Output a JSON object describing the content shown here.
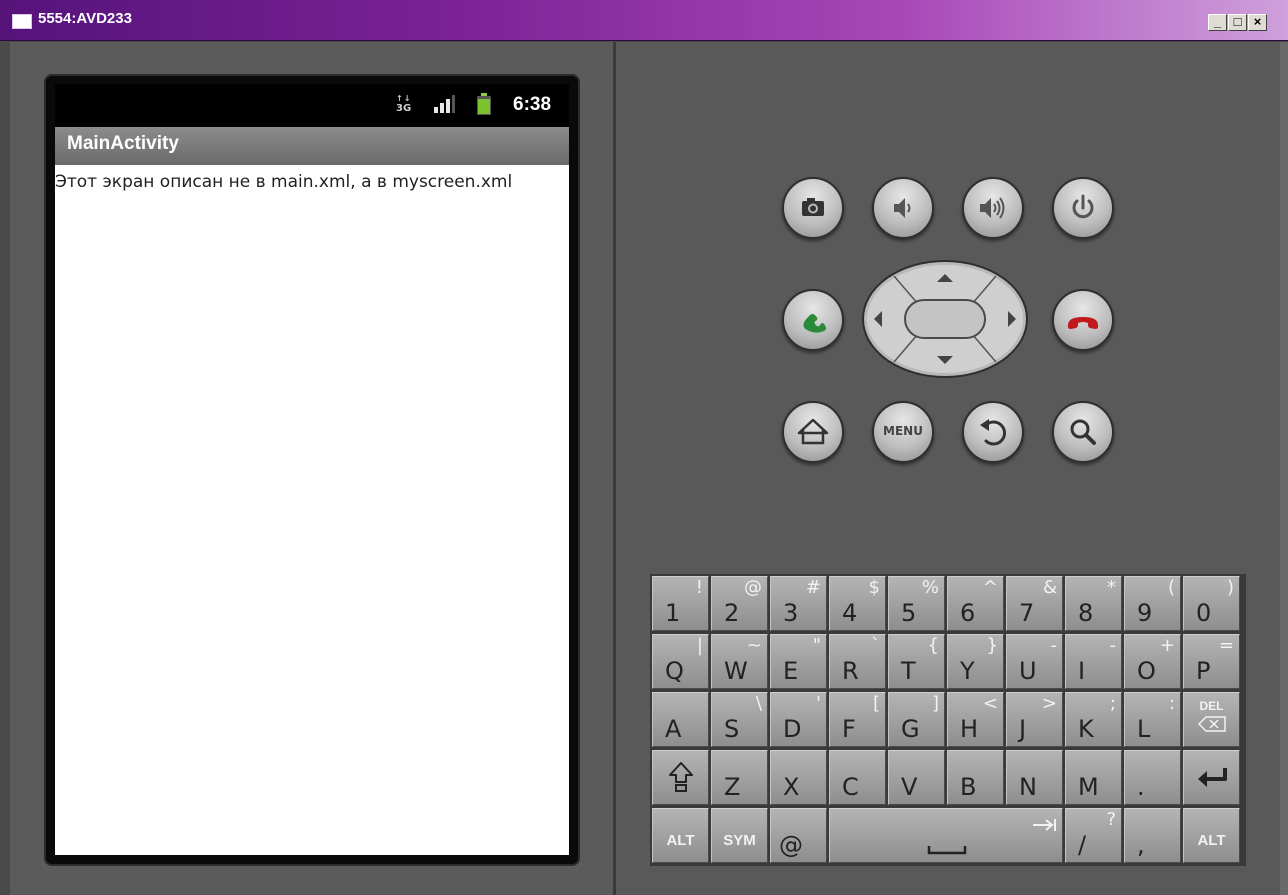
{
  "window": {
    "title": "5554:AVD233",
    "minimize_label": "_",
    "maximize_label": "□",
    "close_label": "×"
  },
  "device": {
    "status_bar": {
      "network": "3G",
      "time": "6:38"
    },
    "app_title": "MainActivity",
    "content_text": "Этот экран описан не в main.xml, а в myscreen.xml"
  },
  "hardware_buttons": {
    "menu_label": "MENU",
    "icons": [
      "camera-icon",
      "volume-down-icon",
      "volume-up-icon",
      "power-icon",
      "call-icon",
      "end-call-icon",
      "home-icon",
      "back-icon",
      "search-icon"
    ]
  },
  "keyboard": {
    "rows": [
      [
        {
          "main": "1",
          "alt": "!"
        },
        {
          "main": "2",
          "alt": "@"
        },
        {
          "main": "3",
          "alt": "#"
        },
        {
          "main": "4",
          "alt": "$"
        },
        {
          "main": "5",
          "alt": "%"
        },
        {
          "main": "6",
          "alt": "^"
        },
        {
          "main": "7",
          "alt": "&"
        },
        {
          "main": "8",
          "alt": "*"
        },
        {
          "main": "9",
          "alt": "("
        },
        {
          "main": "0",
          "alt": ")"
        }
      ],
      [
        {
          "main": "Q",
          "alt": "|"
        },
        {
          "main": "W",
          "alt": "~"
        },
        {
          "main": "E",
          "alt": "\""
        },
        {
          "main": "R",
          "alt": "`"
        },
        {
          "main": "T",
          "alt": "{"
        },
        {
          "main": "Y",
          "alt": "}"
        },
        {
          "main": "U",
          "alt": "-"
        },
        {
          "main": "I",
          "alt": "-"
        },
        {
          "main": "O",
          "alt": "+"
        },
        {
          "main": "P",
          "alt": "="
        }
      ],
      [
        {
          "main": "A",
          "alt": ""
        },
        {
          "main": "S",
          "alt": "\\"
        },
        {
          "main": "D",
          "alt": "'"
        },
        {
          "main": "F",
          "alt": "["
        },
        {
          "main": "G",
          "alt": "]"
        },
        {
          "main": "H",
          "alt": "<"
        },
        {
          "main": "J",
          "alt": ">"
        },
        {
          "main": "K",
          "alt": ";"
        },
        {
          "main": "L",
          "alt": ":"
        },
        {
          "main": "DEL",
          "alt": ""
        }
      ],
      [
        {
          "main": "",
          "alt": ""
        },
        {
          "main": "Z",
          "alt": ""
        },
        {
          "main": "X",
          "alt": ""
        },
        {
          "main": "C",
          "alt": ""
        },
        {
          "main": "V",
          "alt": ""
        },
        {
          "main": "B",
          "alt": ""
        },
        {
          "main": "N",
          "alt": ""
        },
        {
          "main": "M",
          "alt": ""
        },
        {
          "main": ".",
          "alt": ""
        },
        {
          "main": "",
          "alt": ""
        }
      ],
      [
        {
          "main": "ALT",
          "alt": ""
        },
        {
          "main": "SYM",
          "alt": ""
        },
        {
          "main": "@",
          "alt": ""
        },
        {
          "main": "",
          "alt": ""
        },
        {
          "main": "/",
          "alt": "?"
        },
        {
          "main": ",",
          "alt": ""
        },
        {
          "main": "ALT",
          "alt": ""
        }
      ]
    ]
  }
}
